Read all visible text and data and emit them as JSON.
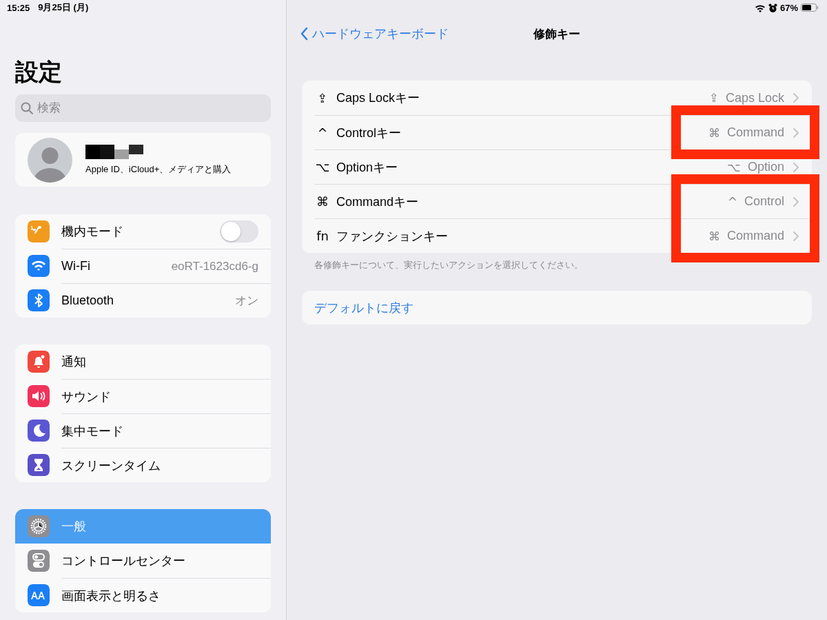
{
  "status_bar": {
    "time": "15:25",
    "date": "9月25日 (月)",
    "battery": "67%"
  },
  "sidebar": {
    "title": "設定",
    "search": {
      "placeholder": "検索"
    },
    "profile": {
      "subtitle": "Apple ID、iCloud+、メディアと購入"
    },
    "groups": [
      {
        "items": [
          {
            "label": "機内モード",
            "kind": "toggle",
            "on": false,
            "color": "#f29a1e",
            "selected": false
          },
          {
            "label": "Wi-Fi",
            "kind": "value",
            "value": "eoRT-1623cd6-g",
            "color": "#1a7ef5",
            "selected": false
          },
          {
            "label": "Bluetooth",
            "kind": "value",
            "value": "オン",
            "color": "#1a7ef5",
            "selected": false
          }
        ]
      },
      {
        "items": [
          {
            "label": "通知",
            "kind": "plain",
            "color": "#f0483e",
            "selected": false
          },
          {
            "label": "サウンド",
            "kind": "plain",
            "color": "#f0335a",
            "selected": false
          },
          {
            "label": "集中モード",
            "kind": "plain",
            "color": "#5b57d3",
            "selected": false
          },
          {
            "label": "スクリーンタイム",
            "kind": "plain",
            "color": "#5b4fc9",
            "selected": false
          }
        ]
      },
      {
        "items": [
          {
            "label": "一般",
            "kind": "plain",
            "color": "#8e8e93",
            "selected": true
          },
          {
            "label": "コントロールセンター",
            "kind": "plain",
            "color": "#8e8e93",
            "selected": false
          },
          {
            "label": "画面表示と明るさ",
            "kind": "plain",
            "color": "#1a7ef5",
            "selected": false
          }
        ]
      }
    ]
  },
  "nav": {
    "back": "ハードウェアキーボード",
    "title": "修飾キー"
  },
  "modifier_keys": {
    "rows": [
      {
        "symbol": "⇪",
        "label": "Caps Lockキー",
        "value_symbol": "⇪",
        "value": "Caps Lock",
        "annotated": false
      },
      {
        "symbol": "^",
        "label": "Controlキー",
        "value_symbol": "⌘",
        "value": "Command",
        "annotated": true
      },
      {
        "symbol": "⌥",
        "label": "Optionキー",
        "value_symbol": "⌥",
        "value": "Option",
        "annotated": false
      },
      {
        "symbol": "⌘",
        "label": "Commandキー",
        "value_symbol": "^",
        "value": "Control",
        "annotated": true
      },
      {
        "symbol": "fn",
        "label": "ファンクションキー",
        "value_symbol": "⌘",
        "value": "Command",
        "annotated": true
      }
    ],
    "footer": "各修飾キーについて、実行したいアクションを選択してください。"
  },
  "reset_button": "デフォルトに戻す"
}
